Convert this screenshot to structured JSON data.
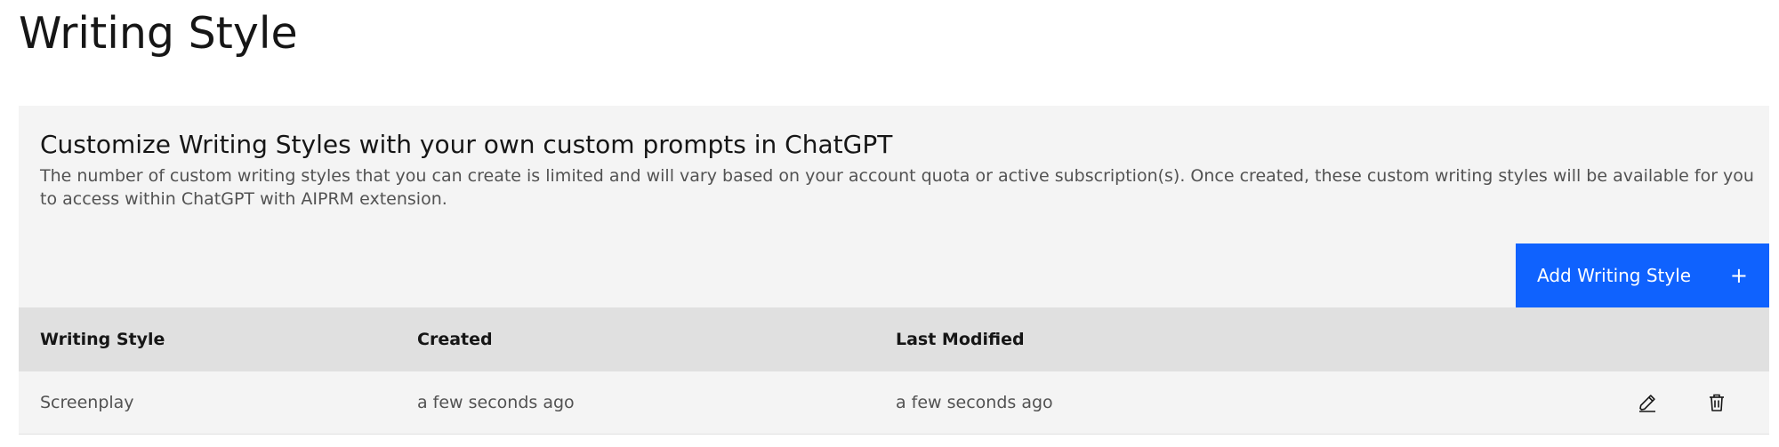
{
  "page": {
    "title": "Writing Style"
  },
  "panel": {
    "heading": "Customize Writing Styles with your own custom prompts in ChatGPT",
    "description": "The number of custom writing styles that you can create is limited and will vary based on your account quota or active subscription(s). Once created, these custom writing styles will be available for you to access within ChatGPT with AIPRM extension.",
    "add_button": {
      "label": "Add Writing Style",
      "icon": "plus-icon"
    }
  },
  "table": {
    "columns": [
      "Writing Style",
      "Created",
      "Last Modified"
    ],
    "rows": [
      {
        "writing_style": "Screenplay",
        "created": "a few seconds ago",
        "last_modified": "a few seconds ago",
        "actions": [
          "edit-icon",
          "delete-icon"
        ]
      }
    ]
  },
  "colors": {
    "accent": "#0f62fe",
    "panel_bg": "#f4f4f4",
    "header_bg": "#e0e0e0",
    "text_primary": "#161616",
    "text_secondary": "#525252"
  }
}
